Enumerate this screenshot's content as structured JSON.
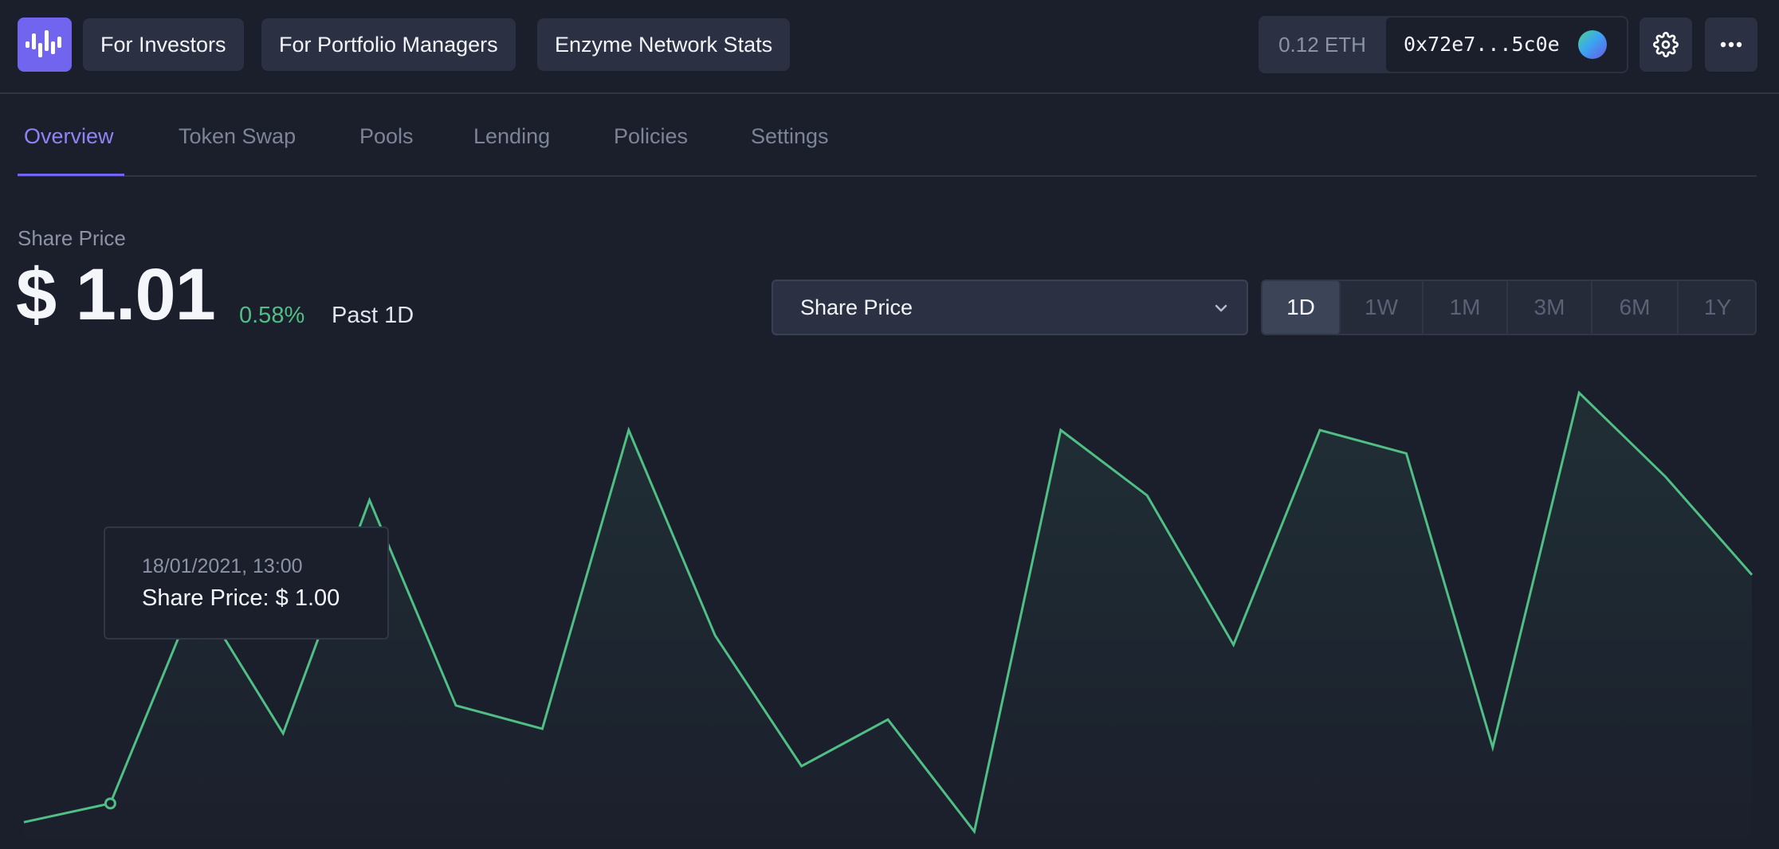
{
  "header": {
    "logo_icon": "enzyme-logo-icon",
    "nav": [
      "For Investors",
      "For Portfolio Managers",
      "Enzyme Network Stats"
    ],
    "wallet": {
      "balance": "0.12 ETH",
      "address": "0x72e7...5c0e",
      "avatar_icon": "wallet-avatar-icon"
    },
    "settings_icon": "gear-icon",
    "more_icon": "more-horizontal-icon"
  },
  "tabs": [
    {
      "label": "Overview",
      "active": true
    },
    {
      "label": "Token Swap",
      "active": false
    },
    {
      "label": "Pools",
      "active": false
    },
    {
      "label": "Lending",
      "active": false
    },
    {
      "label": "Policies",
      "active": false
    },
    {
      "label": "Settings",
      "active": false
    }
  ],
  "summary": {
    "label": "Share Price",
    "value": "$ 1.01",
    "change": "0.58%",
    "period": "Past 1D"
  },
  "metric_select": {
    "selected": "Share Price",
    "icon": "chevron-down-icon"
  },
  "ranges": [
    {
      "label": "1D",
      "active": true
    },
    {
      "label": "1W",
      "active": false
    },
    {
      "label": "1M",
      "active": false
    },
    {
      "label": "3M",
      "active": false
    },
    {
      "label": "6M",
      "active": false
    },
    {
      "label": "1Y",
      "active": false
    }
  ],
  "tooltip": {
    "date": "18/01/2021, 13:00",
    "value": "Share Price: $ 1.00"
  },
  "colors": {
    "line": "#4fbf85",
    "accent": "#7165f0",
    "background": "#1b1f2c",
    "panel": "#2b3142"
  },
  "chart_data": {
    "type": "area",
    "x": [
      0,
      1,
      2,
      3,
      4,
      5,
      6,
      7,
      8,
      9,
      10,
      11,
      12,
      13,
      14,
      15,
      16,
      17,
      18,
      19,
      20
    ],
    "values": [
      0.02,
      0.06,
      0.51,
      0.21,
      0.71,
      0.27,
      0.22,
      0.86,
      0.42,
      0.14,
      0.24,
      0.0,
      0.86,
      0.72,
      0.4,
      0.86,
      0.81,
      0.18,
      0.94,
      0.76,
      0.55
    ],
    "highlight_index": 1,
    "grid": false,
    "xlabel": "",
    "ylabel": ""
  }
}
